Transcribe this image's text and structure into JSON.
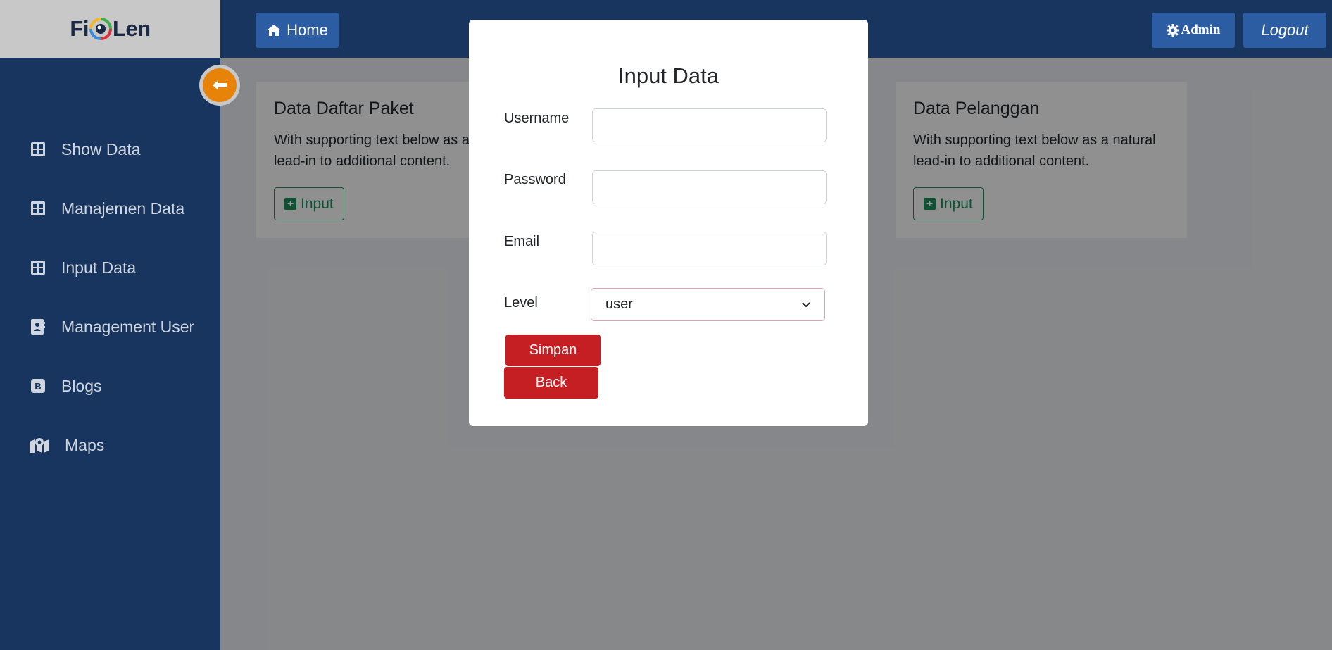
{
  "brand": {
    "text_left": "Fi",
    "text_right": "Len"
  },
  "sidebar": {
    "items": [
      {
        "label": "Show Data",
        "icon": "grid-icon"
      },
      {
        "label": "Manajemen Data",
        "icon": "grid-icon"
      },
      {
        "label": "Input Data",
        "icon": "grid-icon"
      },
      {
        "label": "Management User",
        "icon": "address-book-icon"
      },
      {
        "label": "Blogs",
        "icon": "blogger-icon"
      },
      {
        "label": "Maps",
        "icon": "map-marker-icon"
      }
    ],
    "collapse_icon": "arrow-left-icon"
  },
  "topbar": {
    "home_label": "Home",
    "admin_label": "Admin",
    "logout_label": "Logout"
  },
  "cards": [
    {
      "title": "Data Daftar Paket",
      "text": "With supporting text below as a natural lead-in to additional content.",
      "button": "Input"
    },
    {
      "title": "Data Pelanggan",
      "text": "With supporting text below as a natural lead-in to additional content.",
      "button": "Input"
    }
  ],
  "modal": {
    "title": "Input Data",
    "fields": {
      "username": {
        "label": "Username",
        "value": ""
      },
      "password": {
        "label": "Password",
        "value": ""
      },
      "email": {
        "label": "Email",
        "value": ""
      },
      "level": {
        "label": "Level",
        "value": "user"
      }
    },
    "save_label": "Simpan",
    "back_label": "Back"
  },
  "colors": {
    "sidebar_bg": "#17355f",
    "topbar_button": "#2c5da3",
    "accent_orange": "#e8830a",
    "danger": "#c51f23",
    "success": "#198754"
  }
}
